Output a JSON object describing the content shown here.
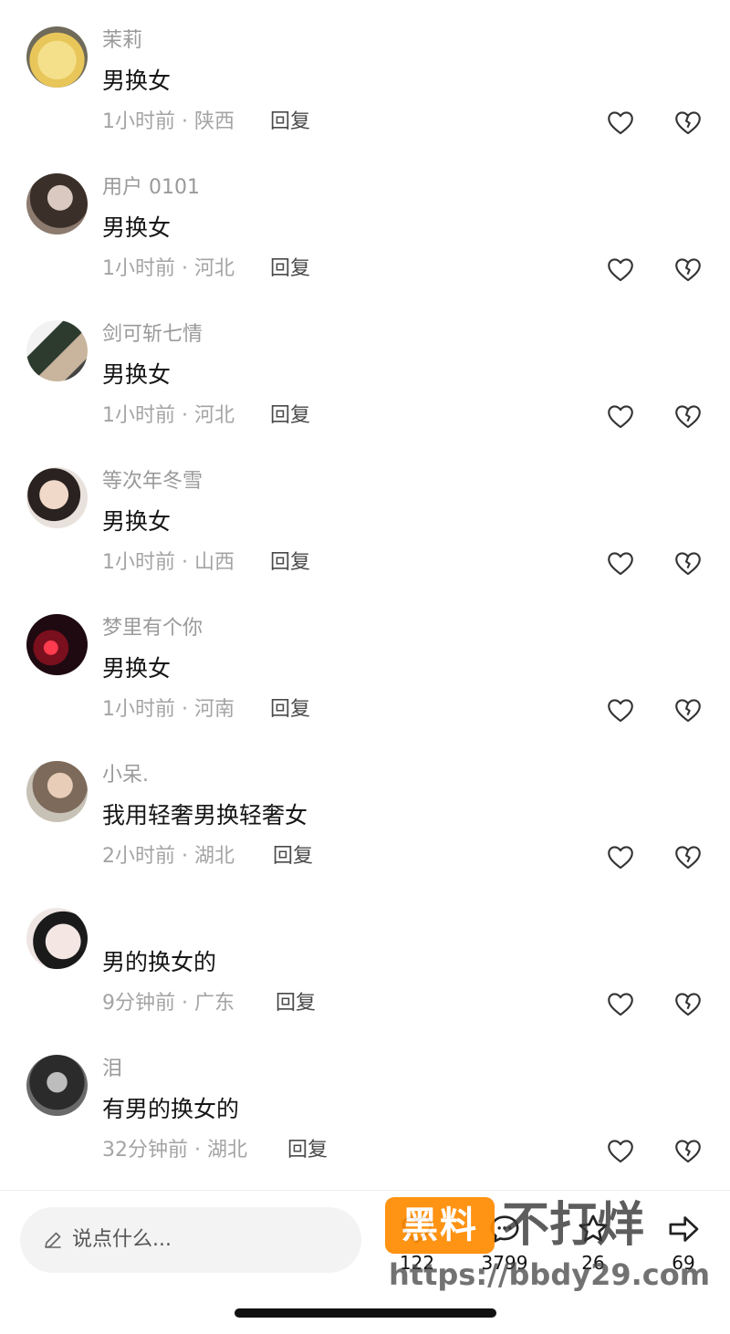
{
  "comments": [
    {
      "username": "茉莉",
      "text": "男换女",
      "time_location": "1小时前 · 陕西",
      "reply_label": "回复"
    },
    {
      "username": "用户 0101",
      "text": "男换女",
      "time_location": "1小时前 · 河北",
      "reply_label": "回复"
    },
    {
      "username": "剑可斩七情",
      "text": "男换女",
      "time_location": "1小时前 · 河北",
      "reply_label": "回复"
    },
    {
      "username": "等次年冬雪",
      "text": "男换女",
      "time_location": "1小时前 · 山西",
      "reply_label": "回复"
    },
    {
      "username": "梦里有个你",
      "text": "男换女",
      "time_location": "1小时前 · 河南",
      "reply_label": "回复"
    },
    {
      "username": "小呆.",
      "text": "我用轻奢男换轻奢女",
      "time_location": "2小时前 · 湖北",
      "reply_label": "回复"
    },
    {
      "username": "",
      "text": "男的换女的",
      "time_location": "9分钟前 · 广东",
      "reply_label": "回复"
    },
    {
      "username": "泪",
      "text": "有男的换女的",
      "time_location": "32分钟前 · 湖北",
      "reply_label": "回复"
    }
  ],
  "bottom_bar": {
    "input_placeholder": "说点什么...",
    "like_count": "122",
    "comment_count": "3799",
    "favorite_count": "26",
    "share_count": "69"
  },
  "watermark": {
    "badge": "黑料",
    "title": "不打烊",
    "url": "https://bbdy29.com"
  },
  "icons": {
    "like": "heart-outline-icon",
    "dislike": "broken-heart-icon",
    "input": "pen-icon",
    "share": "share-arrow-icon"
  },
  "colors": {
    "text_primary": "#161616",
    "text_secondary": "#a4a4a4",
    "watermark_badge": "#ff8a00"
  }
}
